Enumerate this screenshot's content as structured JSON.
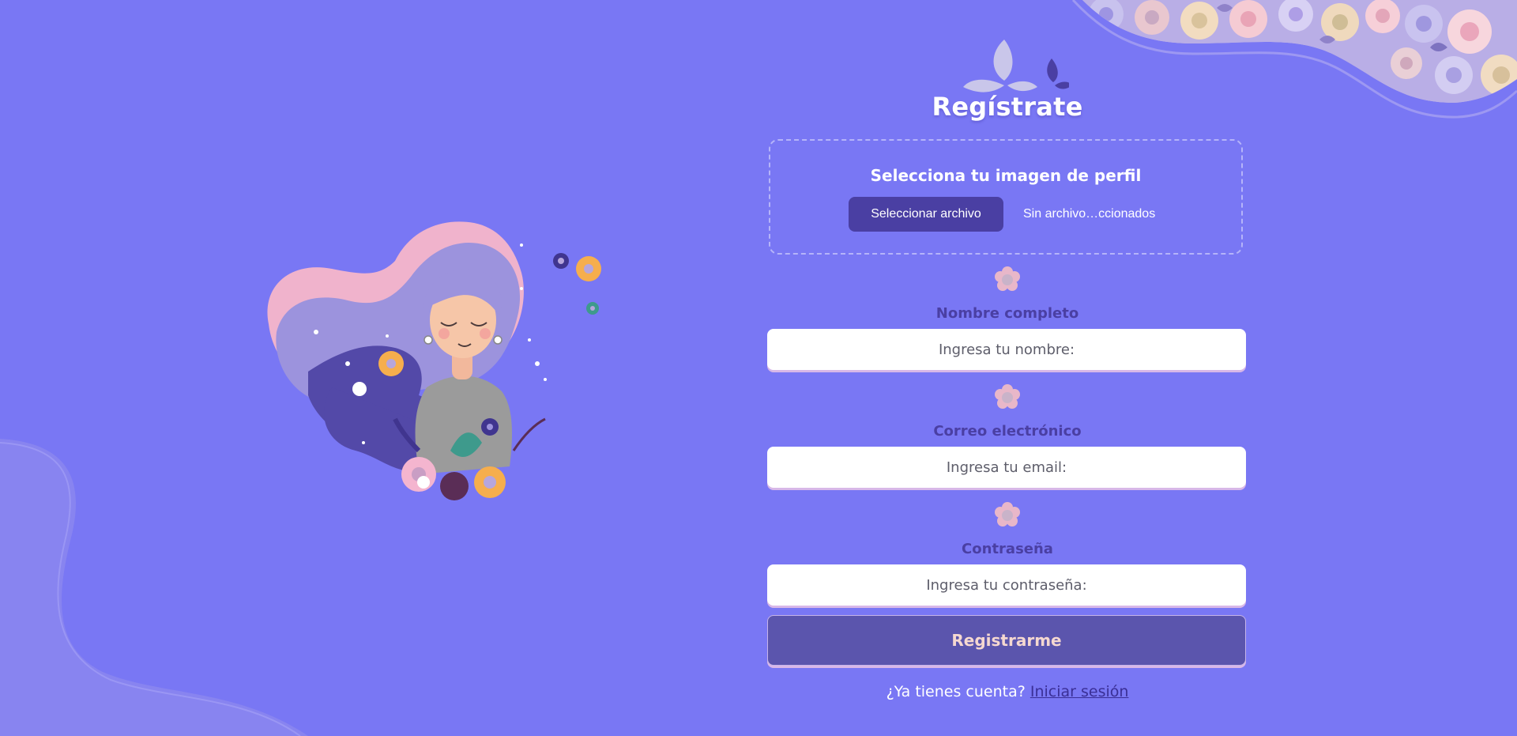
{
  "form": {
    "title": "Regístrate",
    "upload_title": "Selecciona tu imagen de perfil",
    "upload_button": "Seleccionar archivo",
    "upload_status": "Sin archivo…ccionados",
    "name_label": "Nombre completo",
    "name_placeholder": "Ingresa tu nombre:",
    "email_label": "Correo electrónico",
    "email_placeholder": "Ingresa tu email:",
    "password_label": "Contraseña",
    "password_placeholder": "Ingresa tu contraseña:",
    "submit_label": "Registrarme",
    "login_prompt": "¿Ya tienes cuenta?",
    "login_link": "Iniciar sesión"
  },
  "colors": {
    "background": "#7977f4",
    "button_dark": "#4a3fa3",
    "submit": "#5b55ad",
    "label": "#4a3fa3"
  },
  "icons": [
    "leaves-logo-icon",
    "flower-separator-icon",
    "woman-flowers-illustration",
    "flower-border-decoration",
    "wave-decoration"
  ]
}
